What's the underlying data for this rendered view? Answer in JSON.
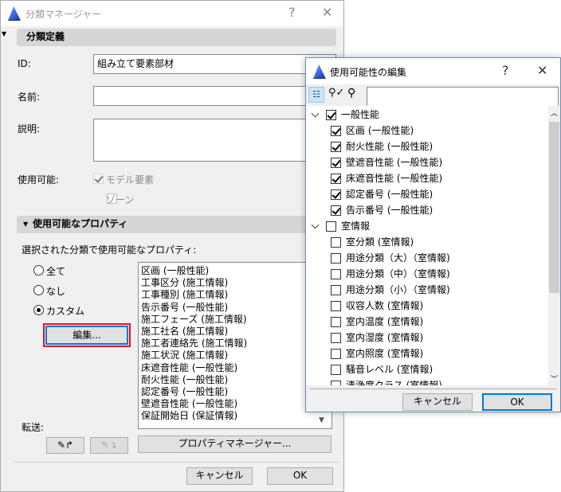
{
  "main": {
    "title": "分類マネージャー",
    "help": "?",
    "close": "✕",
    "section1": "分類定義",
    "id_label": "ID:",
    "id_value": "組み立て要素部材",
    "name_label": "名前:",
    "name_value": "",
    "desc_label": "説明:",
    "desc_value": "",
    "avail_label": "使用可能:",
    "model_elements": "モデル要素",
    "zone": "ゾーン",
    "section2": "使用可能なプロパティ",
    "props_label": "選択された分類で使用可能なプロパティ:",
    "radio_all": "全て",
    "radio_none": "なし",
    "radio_custom": "カスタム",
    "edit_button": "編集...",
    "properties": [
      "区画 (一般性能)",
      "工事区分 (施工情報)",
      "工事種別 (施工情報)",
      "告示番号 (一般性能)",
      "施工フェーズ (施工情報)",
      "施工社名 (施工情報)",
      "施工者連絡先 (施工情報)",
      "施工状況 (施工情報)",
      "床遮音性能 (一般性能)",
      "耐火性能 (一般性能)",
      "認定番号 (一般性能)",
      "壁遮音性能 (一般性能)",
      "保証開始日 (保証情報)"
    ],
    "transfer_label": "転送:",
    "property_manager_button": "プロパティマネージャー...",
    "cancel": "キャンセル",
    "ok": "OK"
  },
  "dialog": {
    "title": "使用可能性の編集",
    "help": "?",
    "close": "✕",
    "search_value": "",
    "groups": [
      {
        "label": "一般性能",
        "checked": true,
        "items": [
          {
            "label": "区画 (一般性能)",
            "checked": true
          },
          {
            "label": "耐火性能 (一般性能)",
            "checked": true
          },
          {
            "label": "壁遮音性能 (一般性能)",
            "checked": true
          },
          {
            "label": "床遮音性能 (一般性能)",
            "checked": true
          },
          {
            "label": "認定番号 (一般性能)",
            "checked": true
          },
          {
            "label": "告示番号 (一般性能)",
            "checked": true
          }
        ]
      },
      {
        "label": "室情報",
        "checked": false,
        "items": [
          {
            "label": "室分類 (室情報)",
            "checked": false
          },
          {
            "label": "用途分類（大）（室情報)",
            "checked": false
          },
          {
            "label": "用途分類（中）（室情報)",
            "checked": false
          },
          {
            "label": "用途分類（小）（室情報)",
            "checked": false
          },
          {
            "label": "収容人数 (室情報)",
            "checked": false
          },
          {
            "label": "室内温度 (室情報)",
            "checked": false
          },
          {
            "label": "室内湿度 (室情報)",
            "checked": false
          },
          {
            "label": "室内照度 (室情報)",
            "checked": false
          },
          {
            "label": "騒音レベル (室情報)",
            "checked": false
          },
          {
            "label": "清浄度クラス (室情報)",
            "checked": false
          }
        ]
      }
    ],
    "cancel": "キャンセル",
    "ok": "OK"
  },
  "colors": {
    "highlight": "#e81123",
    "focus": "#0078d7"
  }
}
